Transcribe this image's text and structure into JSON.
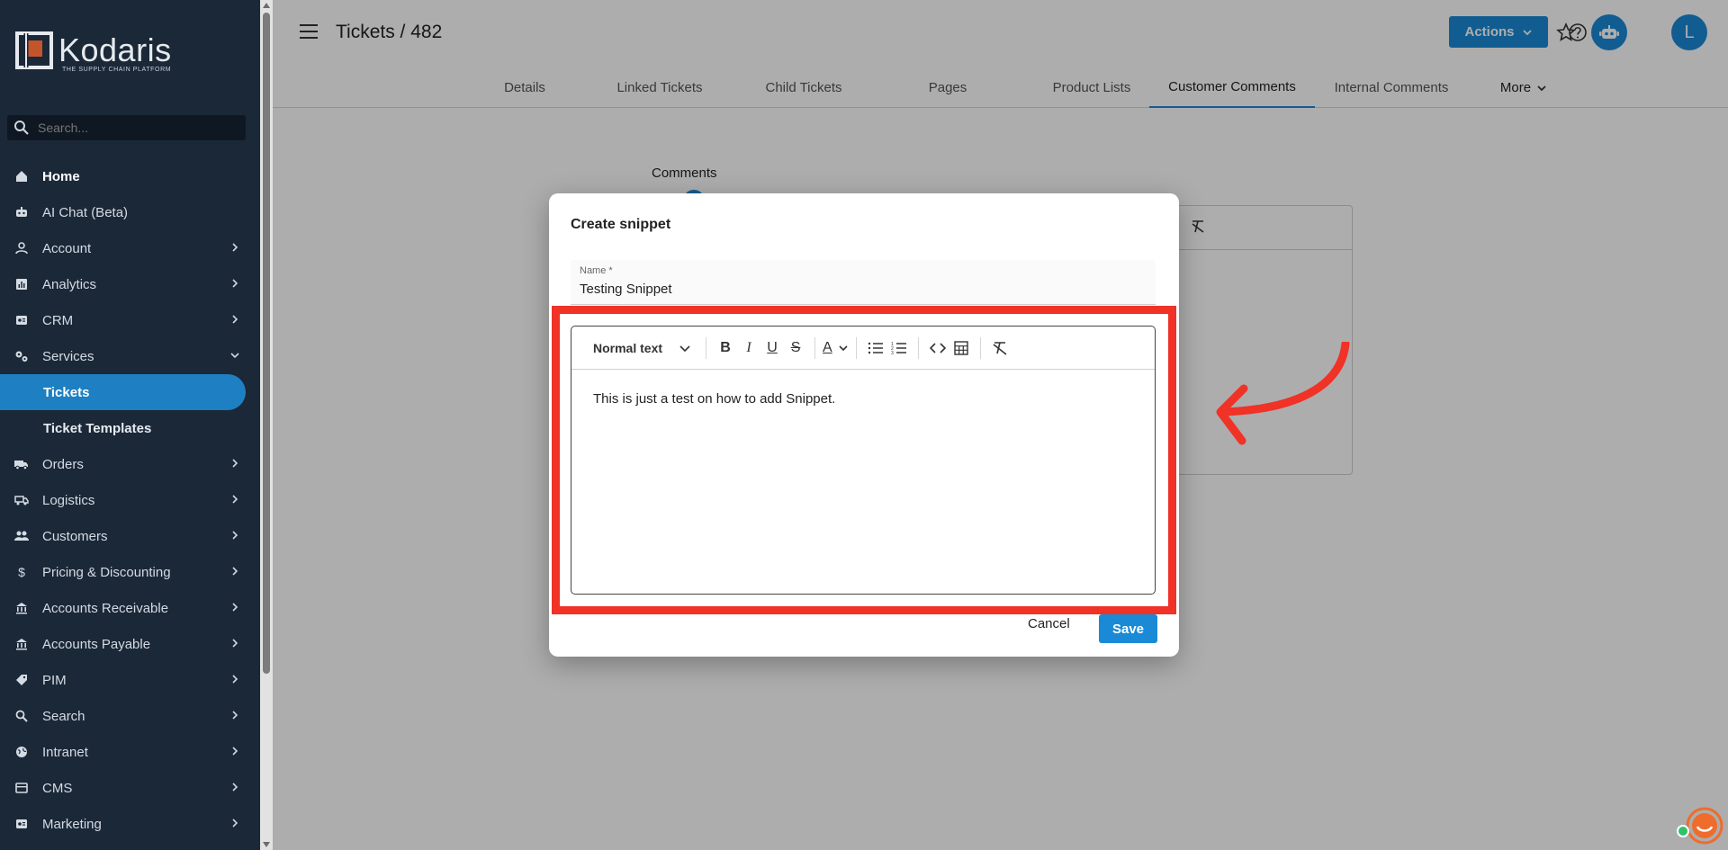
{
  "sidebar": {
    "logo_name": "Kodaris",
    "logo_tagline": "THE SUPPLY CHAIN PLATFORM",
    "search_placeholder": "Search...",
    "items": [
      {
        "label": "Home",
        "icon": "home-icon",
        "bold": true,
        "chevron": false
      },
      {
        "label": "AI Chat (Beta)",
        "icon": "robot-icon",
        "chevron": false
      },
      {
        "label": "Account",
        "icon": "person-icon",
        "chevron": true
      },
      {
        "label": "Analytics",
        "icon": "analytics-icon",
        "chevron": true
      },
      {
        "label": "CRM",
        "icon": "crm-icon",
        "chevron": true
      },
      {
        "label": "Services",
        "icon": "services-icon",
        "chevron": "down"
      },
      {
        "label": "Tickets",
        "active": true
      },
      {
        "label": "Ticket Templates",
        "sub": true
      },
      {
        "label": "Orders",
        "icon": "truck-icon",
        "chevron": true
      },
      {
        "label": "Logistics",
        "icon": "logistics-icon",
        "chevron": true
      },
      {
        "label": "Customers",
        "icon": "people-icon",
        "chevron": true
      },
      {
        "label": "Pricing & Discounting",
        "icon": "dollar-icon",
        "chevron": true
      },
      {
        "label": "Accounts Receivable",
        "icon": "bank-icon",
        "chevron": true
      },
      {
        "label": "Accounts Payable",
        "icon": "bank-icon",
        "chevron": true
      },
      {
        "label": "PIM",
        "icon": "tag-icon",
        "chevron": true
      },
      {
        "label": "Search",
        "icon": "search-icon",
        "chevron": true
      },
      {
        "label": "Intranet",
        "icon": "globe-icon",
        "chevron": true
      },
      {
        "label": "CMS",
        "icon": "cms-icon",
        "chevron": true
      },
      {
        "label": "Marketing",
        "icon": "marketing-icon",
        "chevron": true
      }
    ]
  },
  "header": {
    "title": "Tickets / 482",
    "actions_label": "Actions",
    "avatar_initial": "L"
  },
  "tabs": [
    {
      "label": "Details"
    },
    {
      "label": "Linked Tickets"
    },
    {
      "label": "Child Tickets"
    },
    {
      "label": "Pages"
    },
    {
      "label": "Product Lists"
    },
    {
      "label": "Customer Comments",
      "active": true
    },
    {
      "label": "Internal Comments"
    },
    {
      "label": "More"
    }
  ],
  "content": {
    "comments_label": "Comments"
  },
  "modal": {
    "title": "Create snippet",
    "name_label": "Name *",
    "name_value": "Testing Snippet",
    "toolbar": {
      "text_style": "Normal text",
      "font_color_label": "A"
    },
    "body_text": "This is just a test on how to add Snippet.",
    "cancel_label": "Cancel",
    "save_label": "Save"
  },
  "colors": {
    "sidebar_bg": "#1b2838",
    "accent": "#1a8ad6",
    "highlight": "#f03227",
    "chat": "#ef6c2c"
  }
}
